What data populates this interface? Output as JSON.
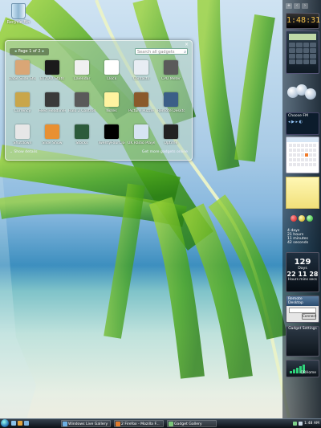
{
  "desktop": {
    "recycle_bin": "Recycle Bin"
  },
  "gallery": {
    "page_label": "Page 1 of 2",
    "search_placeholder": "Search all gadgets",
    "close": "×",
    "details_label": "Show details",
    "online_label": "Get more gadgets online",
    "tiles": [
      {
        "label": "Babe Slide Show",
        "color": "#d9a676"
      },
      {
        "label": "BT/LAX Stats",
        "color": "#1b1b1b"
      },
      {
        "label": "Calendar",
        "color": "#f0f0f0"
      },
      {
        "label": "Clock",
        "color": "#ffffff"
      },
      {
        "label": "Contacts",
        "color": "#e8edf3"
      },
      {
        "label": "CPU Meter",
        "color": "#5a5a5a"
      },
      {
        "label": "Currency",
        "color": "#c9a64a"
      },
      {
        "label": "Feed Headlines",
        "color": "#3a3a3a"
      },
      {
        "label": "Halo 2 Controll...",
        "color": "#5a5a5a"
      },
      {
        "label": "Notes",
        "color": "#fff3a0"
      },
      {
        "label": "Picture Puzzle",
        "color": "#8a5a2b"
      },
      {
        "label": "Remote Desktop",
        "color": "#3b5f87"
      },
      {
        "label": "Shutdown",
        "color": "#e7e7e7"
      },
      {
        "label": "Slide Show",
        "color": "#e89032"
      },
      {
        "label": "Stocks",
        "color": "#2c5b3b"
      },
      {
        "label": "TwentyFourClock",
        "color": "#000000"
      },
      {
        "label": "UK Radio Player",
        "color": "#d6e4f2"
      },
      {
        "label": "Uptime",
        "color": "#222222"
      }
    ]
  },
  "sidebar": {
    "clock_time": "1:48:31",
    "fm_title": "Choose FM",
    "uptime": [
      "4 days",
      "21 hours",
      "11 minutes",
      "42 seconds"
    ],
    "countdown": {
      "big": "129",
      "unit": "Days",
      "time": "22 11 28",
      "caption": "Hours mins secs"
    },
    "rdp_title": "Remote Desktop",
    "rdp_connect": "Connect",
    "tile_label": "Gadget Settings",
    "signal_label": "QRHome"
  },
  "taskbar": {
    "items": [
      {
        "label": "Windows Live Gallery",
        "color": "#6db0e3"
      },
      {
        "label": "2 Firefox - Mozilla F...",
        "color": "#e07b2d"
      },
      {
        "label": "Gadget Gallery",
        "color": "#7cc67a"
      }
    ],
    "time": "1:48 AM"
  }
}
